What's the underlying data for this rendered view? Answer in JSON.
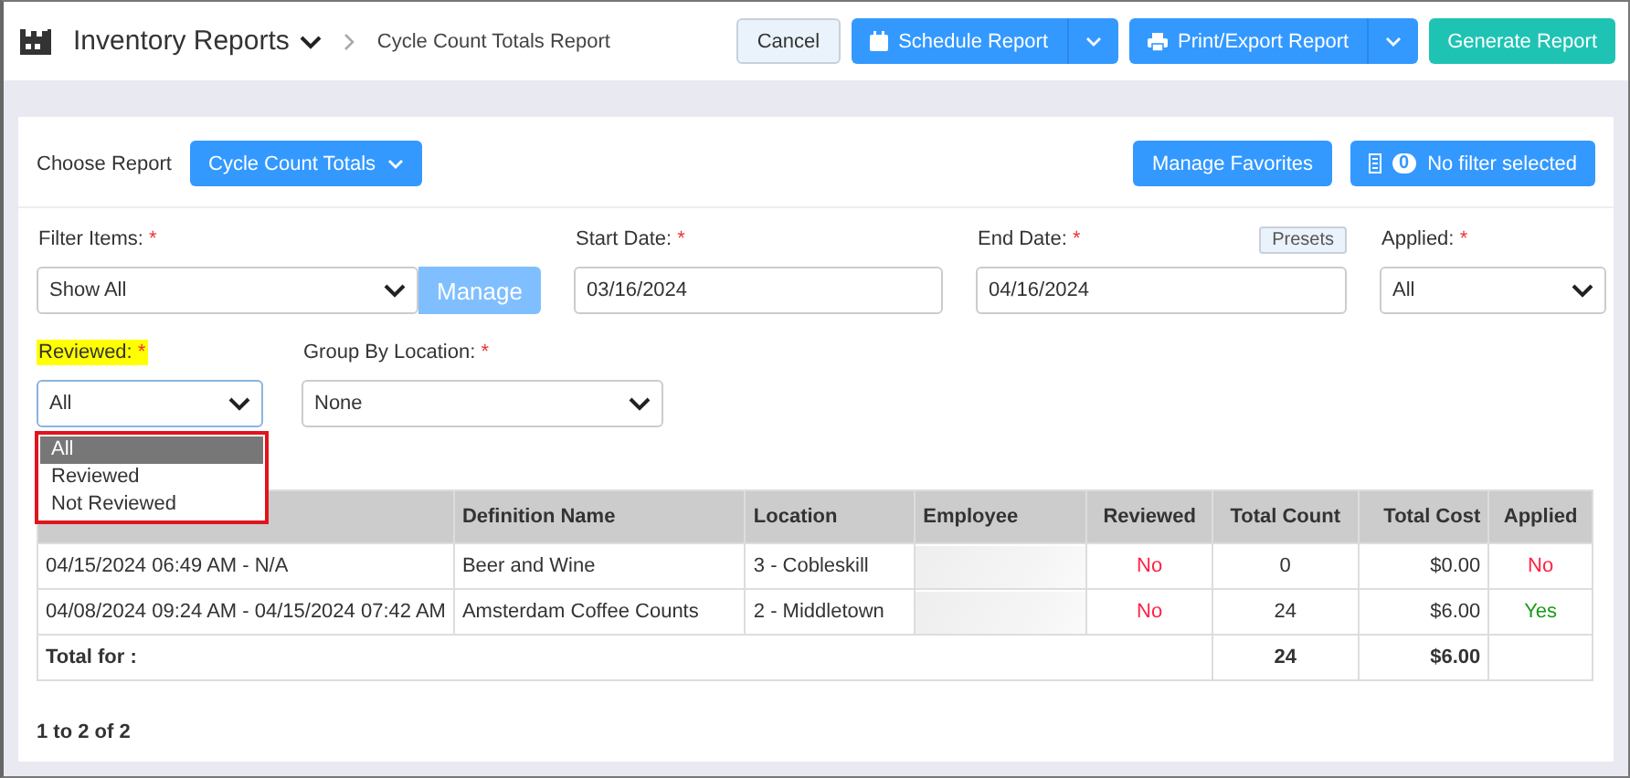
{
  "header": {
    "title": "Inventory Reports",
    "breadcrumb": "Cycle Count Totals Report",
    "buttons": [
      {
        "label": "Cancel",
        "kind": "plain"
      },
      {
        "label": "Schedule Report",
        "kind": "calendar"
      },
      {
        "label": "Print/Export Report",
        "kind": "print"
      },
      {
        "label": "Generate Report",
        "kind": "primary"
      }
    ]
  },
  "report": {
    "label": "Choose Report",
    "value": "Cycle Count Totals",
    "favorites": "Manage Favorites",
    "filter_count": "0",
    "filter_label": "No filter selected"
  },
  "filters": [
    {
      "label": "Filter Items:",
      "required_mark": "*",
      "kind": "select",
      "value": "Show All",
      "button": "Manage"
    },
    {
      "label": "Start Date:",
      "required_mark": "*",
      "kind": "input",
      "value": "03/16/2024"
    },
    {
      "label": "End Date:",
      "required_mark": "*",
      "kind": "input",
      "value": "04/16/2024",
      "button": "Presets"
    },
    {
      "label": "Applied:",
      "required_mark": "*",
      "kind": "select",
      "value": "All"
    }
  ],
  "filters2": [
    {
      "label": "Reviewed:",
      "required_mark": "*",
      "kind": "select",
      "value": "All",
      "highlighted": true,
      "open": true
    },
    {
      "label": "Group By Location:",
      "required_mark": "*",
      "kind": "select",
      "value": "None",
      "highlighted": false,
      "open": false
    }
  ],
  "dropdown": [
    {
      "label": "All",
      "selected": true
    },
    {
      "label": "Reviewed",
      "selected": false
    },
    {
      "label": "Not Reviewed",
      "selected": false
    }
  ],
  "table": {
    "columns": [
      "Definition Name",
      "Location",
      "Employee",
      "Reviewed",
      "Total Count",
      "Total Cost",
      "Applied"
    ],
    "rows": [
      {
        "date": "04/15/2024 06:49 AM - N/A",
        "definition": "Beer and Wine",
        "location": "3 - Cobleskill",
        "reviewed": {
          "text": "No",
          "ok": false
        },
        "count": "0",
        "cost": "$0.00",
        "applied": {
          "text": "No",
          "ok": false
        }
      },
      {
        "date": "04/08/2024 09:24 AM - 04/15/2024 07:42 AM",
        "definition": "Amsterdam Coffee Counts",
        "location": "2 - Middletown",
        "reviewed": {
          "text": "No",
          "ok": false
        },
        "count": "24",
        "cost": "$6.00",
        "applied": {
          "text": "Yes",
          "ok": true
        }
      }
    ],
    "total": {
      "label": "Total for :",
      "count": "24",
      "cost": "$6.00"
    }
  },
  "pager": "1 to 2 of 2"
}
